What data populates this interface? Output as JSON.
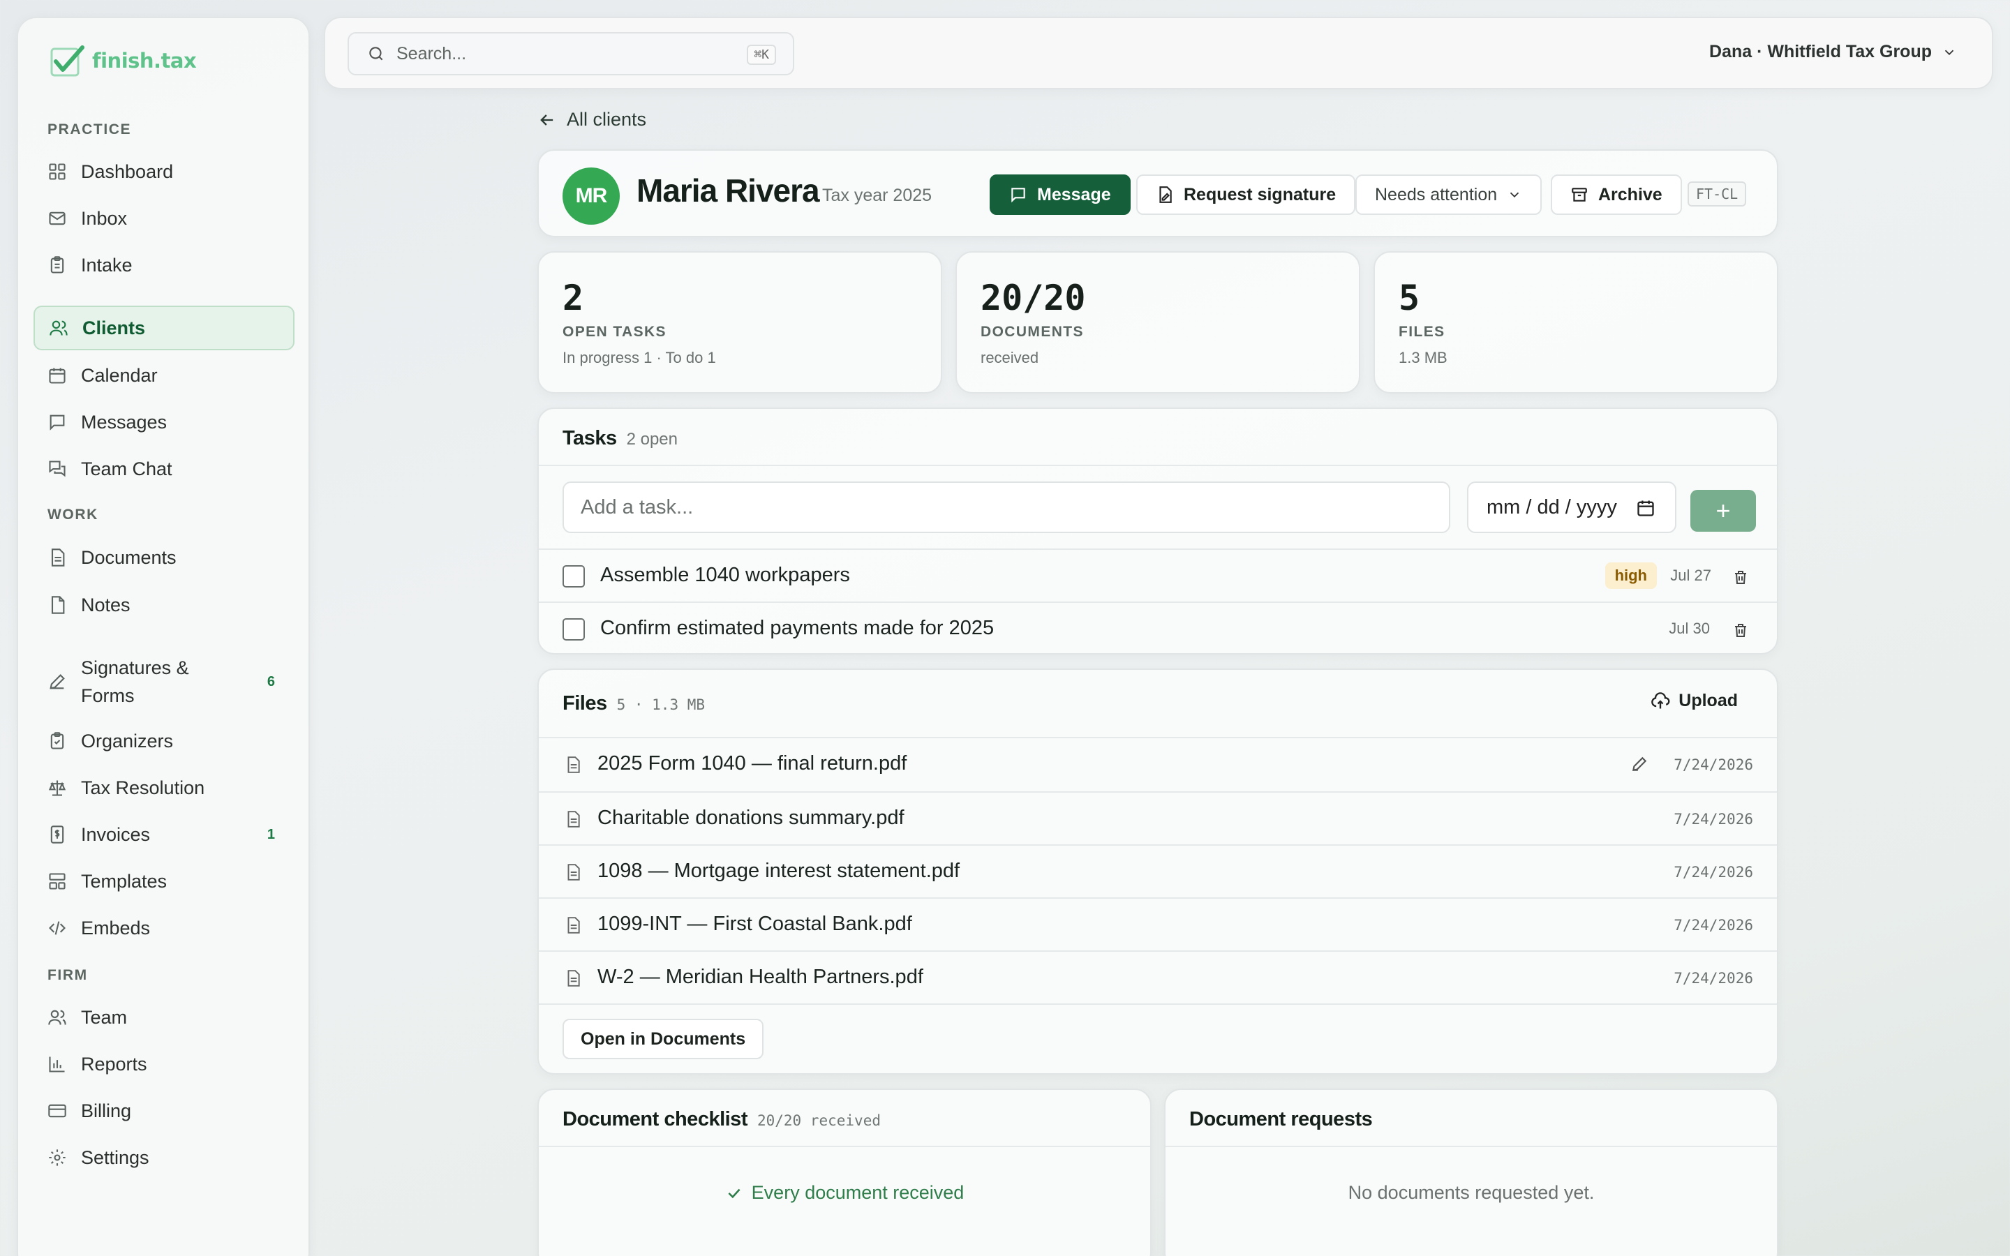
{
  "app": {
    "logo_text": "finish.tax"
  },
  "sidebar": {
    "sections": [
      {
        "label": "PRACTICE",
        "items": [
          {
            "label": "Dashboard",
            "icon": "grid-icon"
          },
          {
            "label": "Inbox",
            "icon": "mail-icon"
          },
          {
            "label": "Intake",
            "icon": "clipboard-icon"
          },
          {
            "label": "Clients",
            "icon": "users-icon",
            "active": true
          },
          {
            "label": "Calendar",
            "icon": "calendar-icon"
          },
          {
            "label": "Messages",
            "icon": "message-icon"
          },
          {
            "label": "Team Chat",
            "icon": "chat-icon"
          }
        ]
      },
      {
        "label": "WORK",
        "items": [
          {
            "label": "Documents",
            "icon": "file-text-icon"
          },
          {
            "label": "Notes",
            "icon": "note-icon"
          },
          {
            "label": "Signatures & Forms",
            "icon": "pen-icon",
            "badge": "6"
          },
          {
            "label": "Organizers",
            "icon": "clipboard-check-icon"
          },
          {
            "label": "Tax Resolution",
            "icon": "scale-icon"
          },
          {
            "label": "Invoices",
            "icon": "invoice-icon",
            "badge": "1"
          },
          {
            "label": "Templates",
            "icon": "template-icon"
          },
          {
            "label": "Embeds",
            "icon": "code-icon"
          }
        ]
      },
      {
        "label": "FIRM",
        "items": [
          {
            "label": "Team",
            "icon": "users-icon"
          },
          {
            "label": "Reports",
            "icon": "bar-chart-icon"
          },
          {
            "label": "Billing",
            "icon": "credit-card-icon"
          },
          {
            "label": "Settings",
            "icon": "gear-icon"
          }
        ]
      }
    ]
  },
  "topbar": {
    "search_placeholder": "Search...",
    "search_shortcut": "⌘K",
    "account": "Dana · Whitfield Tax Group"
  },
  "breadcrumb": {
    "back_label": "All clients"
  },
  "client": {
    "initials": "MR",
    "name": "Maria Rivera",
    "tax_year": "Tax year 2025",
    "code": "FT-CL",
    "avatar_color": "#34a853"
  },
  "actions": {
    "message": "Message",
    "request_signature": "Request signature",
    "status": "Needs attention",
    "archive": "Archive"
  },
  "stats": [
    {
      "value": "2",
      "label": "OPEN TASKS",
      "sub": "In progress 1 · To do 1"
    },
    {
      "value": "20/20",
      "label": "DOCUMENTS",
      "sub": "received"
    },
    {
      "value": "5",
      "label": "FILES",
      "sub": "1.3 MB"
    }
  ],
  "tasks": {
    "title": "Tasks",
    "meta": "2 open",
    "input_placeholder": "Add a task...",
    "date_placeholder": "mm / dd / yyyy",
    "add_label": "+",
    "items": [
      {
        "text": "Assemble 1040 workpapers",
        "priority": "high",
        "due": "Jul 27"
      },
      {
        "text": "Confirm estimated payments made for 2025",
        "priority": "",
        "due": "Jul 30"
      }
    ]
  },
  "files": {
    "title": "Files",
    "meta": "5 · 1.3 MB",
    "upload_label": "Upload",
    "open_label": "Open in Documents",
    "items": [
      {
        "name": "2025 Form 1040 — final return.pdf",
        "date": "7/24/2026",
        "editable": true
      },
      {
        "name": "Charitable donations summary.pdf",
        "date": "7/24/2026"
      },
      {
        "name": "1098 — Mortgage interest statement.pdf",
        "date": "7/24/2026"
      },
      {
        "name": "1099-INT — First Coastal Bank.pdf",
        "date": "7/24/2026"
      },
      {
        "name": "W-2 — Meridian Health Partners.pdf",
        "date": "7/24/2026"
      }
    ]
  },
  "checklist": {
    "title": "Document checklist",
    "meta": "20/20 received",
    "message": "Every document received"
  },
  "requests": {
    "title": "Document requests",
    "message": "No documents requested yet."
  },
  "colors": {
    "brand": "#155f3a",
    "brand_light": "#5fc28a",
    "success": "#2e7d4a",
    "priority_high_bg": "#fbefcf"
  }
}
